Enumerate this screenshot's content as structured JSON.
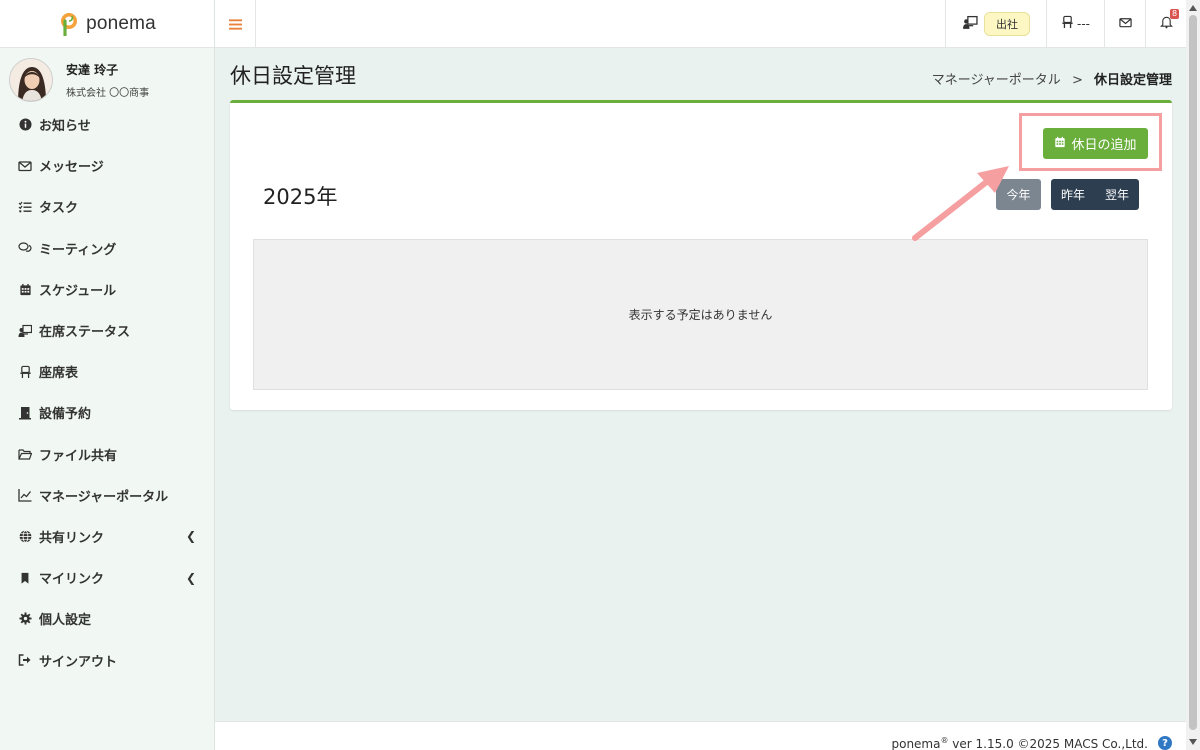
{
  "app": {
    "logo_text": "ponema"
  },
  "user": {
    "name": "安達 玲子",
    "company": "株式会社 〇〇商事"
  },
  "sidebar": {
    "items": [
      {
        "label": "お知らせ",
        "icon": "info-circle-icon"
      },
      {
        "label": "メッセージ",
        "icon": "envelope-icon"
      },
      {
        "label": "タスク",
        "icon": "list-check-icon"
      },
      {
        "label": "ミーティング",
        "icon": "comments-icon"
      },
      {
        "label": "スケジュール",
        "icon": "calendar-icon"
      },
      {
        "label": "在席ステータス",
        "icon": "presence-icon"
      },
      {
        "label": "座席表",
        "icon": "chair-icon"
      },
      {
        "label": "設備予約",
        "icon": "door-icon"
      },
      {
        "label": "ファイル共有",
        "icon": "folder-open-icon"
      },
      {
        "label": "マネージャーポータル",
        "icon": "chart-line-icon"
      },
      {
        "label": "共有リンク",
        "icon": "globe-icon",
        "has_submenu": true
      },
      {
        "label": "マイリンク",
        "icon": "bookmark-icon",
        "has_submenu": true
      },
      {
        "label": "個人設定",
        "icon": "gear-icon"
      },
      {
        "label": "サインアウト",
        "icon": "sign-out-icon"
      }
    ]
  },
  "topbar": {
    "status_label": "出社",
    "seat_label": "---",
    "notification_count": "8"
  },
  "page": {
    "title": "休日設定管理",
    "breadcrumb": {
      "parent": "マネージャーポータル",
      "separator": ">",
      "current": "休日設定管理"
    },
    "add_holiday_label": "休日の追加",
    "year_label": "2025年",
    "today_label": "今年",
    "prev_year_label": "昨年",
    "next_year_label": "翌年",
    "empty_message": "表示する予定はありません"
  },
  "footer": {
    "product": "ponema",
    "trademark": "®",
    "version_text": " ver 1.15.0 ©2025 MACS Co.,Ltd."
  },
  "colors": {
    "accent_green": "#6aae3c",
    "highlight_pink": "#f59fa0",
    "hamburger_orange": "#e8823a",
    "dark_button": "#2c3e50"
  }
}
